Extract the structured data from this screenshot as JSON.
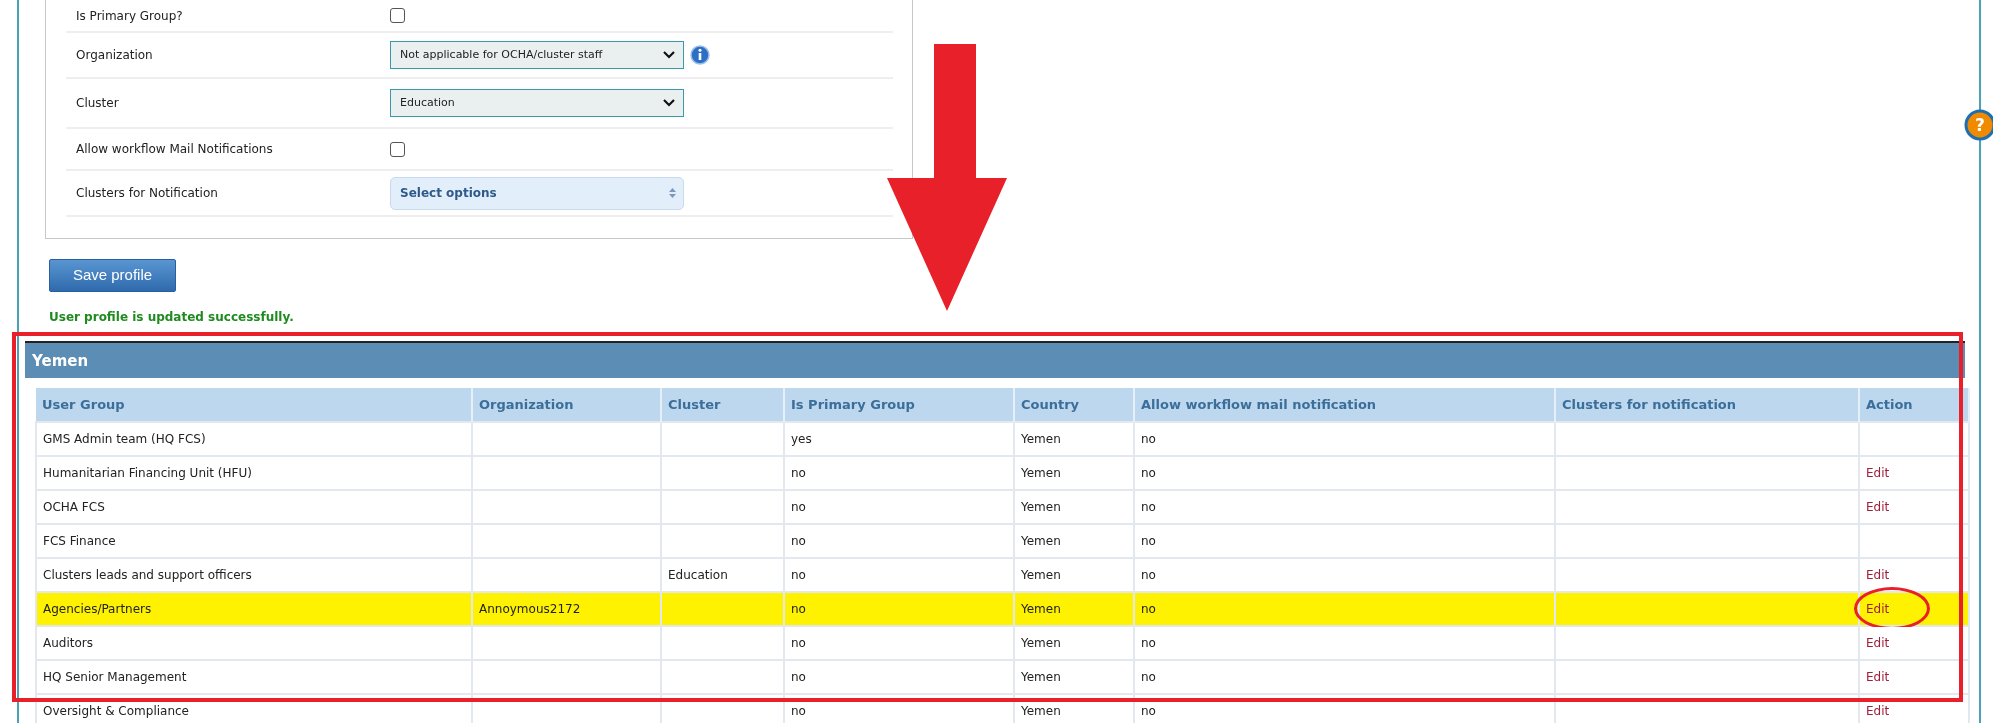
{
  "form": {
    "fields": [
      {
        "label": "Is Primary Group?",
        "kind": "checkbox",
        "checked": false
      },
      {
        "label": "Organization",
        "kind": "select",
        "value": "Not applicable for OCHA/cluster staff",
        "info": true
      },
      {
        "label": "Cluster",
        "kind": "select",
        "value": "Education",
        "info": false
      },
      {
        "label": "Allow workflow Mail Notifications",
        "kind": "checkbox",
        "checked": false
      },
      {
        "label": "Clusters for Notification",
        "kind": "multiselect",
        "value": "Select options"
      }
    ],
    "save_button": "Save profile",
    "message": "User profile is updated successfully."
  },
  "help_button": {
    "label": "?"
  },
  "group_table": {
    "title": "Yemen",
    "columns": [
      "User Group",
      "Organization",
      "Cluster",
      "Is Primary Group",
      "Country",
      "Allow workflow mail notification",
      "Clusters for notification",
      "Action"
    ],
    "rows": [
      {
        "cells": [
          "GMS Admin team (HQ FCS)",
          "",
          "",
          "yes",
          "Yemen",
          "no",
          ""
        ],
        "action": "",
        "selected": false,
        "circled": false
      },
      {
        "cells": [
          "Humanitarian Financing Unit (HFU)",
          "",
          "",
          "no",
          "Yemen",
          "no",
          ""
        ],
        "action": "Edit",
        "selected": false,
        "circled": false
      },
      {
        "cells": [
          "OCHA FCS",
          "",
          "",
          "no",
          "Yemen",
          "no",
          ""
        ],
        "action": "Edit",
        "selected": false,
        "circled": false
      },
      {
        "cells": [
          "FCS Finance",
          "",
          "",
          "no",
          "Yemen",
          "no",
          ""
        ],
        "action": "",
        "selected": false,
        "circled": false
      },
      {
        "cells": [
          "Clusters leads and support officers",
          "",
          "Education",
          "no",
          "Yemen",
          "no",
          ""
        ],
        "action": "Edit",
        "selected": false,
        "circled": false
      },
      {
        "cells": [
          "Agencies/Partners",
          "Annoymous2172",
          "",
          "no",
          "Yemen",
          "no",
          ""
        ],
        "action": "Edit",
        "selected": true,
        "circled": true
      },
      {
        "cells": [
          "Auditors",
          "",
          "",
          "no",
          "Yemen",
          "no",
          ""
        ],
        "action": "Edit",
        "selected": false,
        "circled": false
      },
      {
        "cells": [
          "HQ Senior Management",
          "",
          "",
          "no",
          "Yemen",
          "no",
          ""
        ],
        "action": "Edit",
        "selected": false,
        "circled": false
      },
      {
        "cells": [
          "Oversight & Compliance",
          "",
          "",
          "no",
          "Yemen",
          "no",
          ""
        ],
        "action": "Edit",
        "selected": false,
        "circled": false
      }
    ]
  }
}
